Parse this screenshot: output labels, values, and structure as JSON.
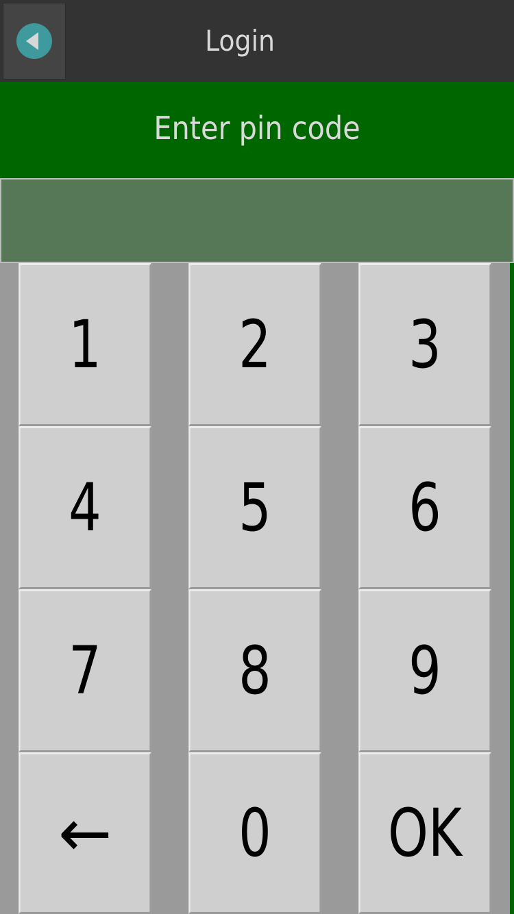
{
  "header": {
    "title": "Login",
    "back_icon": "back-arrow-icon"
  },
  "prompt": {
    "text": "Enter pin code"
  },
  "pin_field": {
    "value": ""
  },
  "keypad": {
    "keys": [
      {
        "label": "1"
      },
      {
        "label": "2"
      },
      {
        "label": "3"
      },
      {
        "label": "4"
      },
      {
        "label": "5"
      },
      {
        "label": "6"
      },
      {
        "label": "7"
      },
      {
        "label": "8"
      },
      {
        "label": "9"
      },
      {
        "label": "←"
      },
      {
        "label": "0"
      },
      {
        "label": "OK"
      }
    ]
  },
  "colors": {
    "header_bg": "#333333",
    "prompt_bg": "#006600",
    "pin_field_bg": "#577857",
    "key_bg": "#cfcfcf",
    "back_icon": "#3f9a9e"
  }
}
